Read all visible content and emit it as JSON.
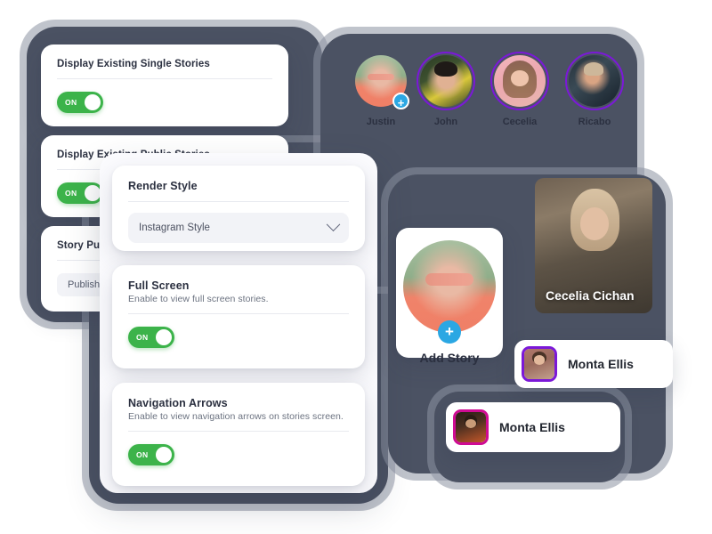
{
  "colors": {
    "toggle_on": "#3cb34a",
    "frame_dark": "#4b5263",
    "ring_purple": "#7b18d8",
    "ring_magenta": "#cf0b93",
    "plus_blue": "#2ba7e3",
    "page_background": "#ffffff"
  },
  "left_panel": {
    "cards": [
      {
        "title": "Display Existing Single Stories",
        "toggle_label": "ON",
        "toggle_state": "on"
      },
      {
        "title": "Display Existing Public Stories",
        "toggle_label": "ON",
        "toggle_state": "on"
      },
      {
        "title": "Story Publish Status",
        "value": "Published"
      }
    ]
  },
  "settings_panel": {
    "render_style": {
      "title": "Render Style",
      "selected_option": "Instagram Style",
      "chevron": "chevron-down-icon"
    },
    "full_screen": {
      "title": "Full Screen",
      "description": "Enable to view full screen stories.",
      "toggle_label": "ON",
      "toggle_state": "on"
    },
    "navigation_arrows": {
      "title": "Navigation Arrows",
      "description": "Enable to view navigation arrows on stories screen.",
      "toggle_label": "ON",
      "toggle_state": "on"
    }
  },
  "stories_row": [
    {
      "name": "Justin",
      "has_ring": false,
      "has_add_badge": true,
      "badge": "+"
    },
    {
      "name": "John",
      "has_ring": true,
      "has_add_badge": false,
      "badge": ""
    },
    {
      "name": "Cecelia",
      "has_ring": true,
      "has_add_badge": false,
      "badge": ""
    },
    {
      "name": "Ricabo",
      "has_ring": true,
      "has_add_badge": false,
      "badge": ""
    }
  ],
  "add_story_card": {
    "label": "Add Story",
    "badge": "+"
  },
  "featured_story": {
    "caption": "Cecelia Cichan"
  },
  "name_rows": [
    {
      "name": "Monta Ellis",
      "ring_color": "purple"
    },
    {
      "name": "Monta Ellis",
      "ring_color": "magenta"
    }
  ]
}
